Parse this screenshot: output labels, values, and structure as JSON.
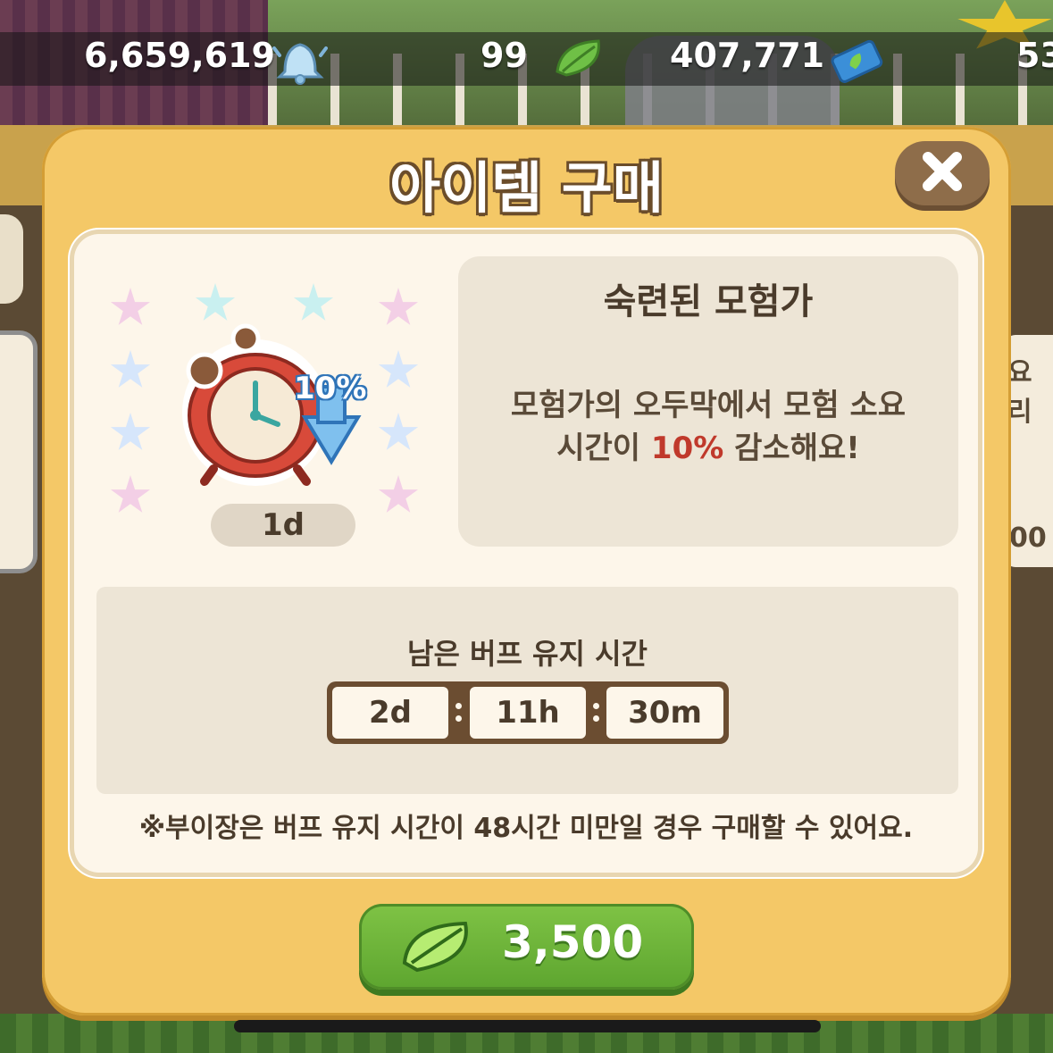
{
  "currency_bar": {
    "bells": "6,659,619",
    "leaves": "99",
    "tickets": "407,771",
    "other": "53"
  },
  "background": {
    "right_card_text_top": "요리",
    "right_card_text_bottom": "00"
  },
  "popup": {
    "title": "아이템 구매",
    "item": {
      "duration": "1d",
      "badge_text": "10%",
      "name": "숙련된 모험가",
      "description_line1": "모험가의 오두막에서 모험 소요",
      "description_prefix": "시간이 ",
      "description_highlight": "10%",
      "description_suffix": " 감소해요!"
    },
    "timer": {
      "label": "남은 버프 유지 시간",
      "days": "2d",
      "hours": "11h",
      "minutes": "30m"
    },
    "notice": "※부이장은 버프 유지 시간이 48시간 미만일 경우 구매할 수 있어요.",
    "buy_button": {
      "price": "3,500",
      "currency_icon": "leaf-icon"
    }
  },
  "colors": {
    "popup_bg": "#f4c867",
    "buy_button": "#6db43a",
    "highlight": "#c0392b",
    "text": "#4a3b2b"
  }
}
